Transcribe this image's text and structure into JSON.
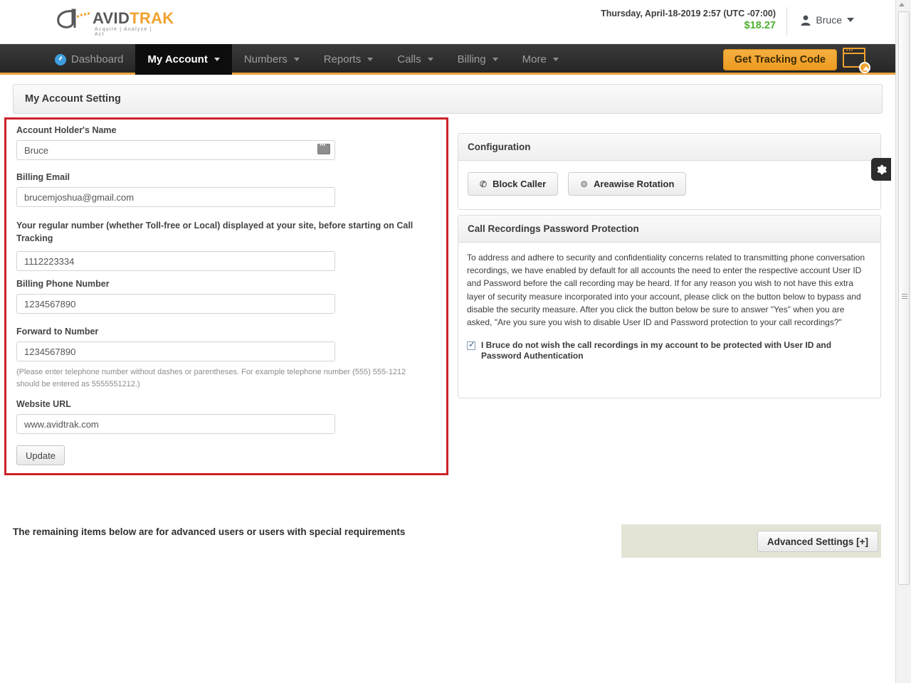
{
  "header": {
    "logo": {
      "mark": "a-mark",
      "avid": "AVID",
      "trak": "TRAK",
      "tagline": "Acquire  |  Analyze  |  Act"
    },
    "datetime": "Thursday, April-18-2019 2:57 (UTC -07:00)",
    "balance": "$18.27",
    "balance_color": "#4caf2f",
    "user_name": "Bruce",
    "user_icon": "user-icon",
    "caret_icon": "chevron-down-icon"
  },
  "nav": {
    "items": [
      {
        "label": "Dashboard",
        "icon": "dashboard-icon",
        "has_caret": false,
        "active": false
      },
      {
        "label": "My Account",
        "icon": "",
        "has_caret": true,
        "active": true
      },
      {
        "label": "Numbers",
        "icon": "",
        "has_caret": true,
        "active": false
      },
      {
        "label": "Reports",
        "icon": "",
        "has_caret": true,
        "active": false
      },
      {
        "label": "Calls",
        "icon": "",
        "has_caret": true,
        "active": false
      },
      {
        "label": "Billing",
        "icon": "",
        "has_caret": true,
        "active": false
      },
      {
        "label": "More",
        "icon": "",
        "has_caret": true,
        "active": false
      }
    ],
    "tracking_button": "Get Tracking Code",
    "tracking_icon": "browser-window-icon",
    "accent_color": "#e8a33d"
  },
  "page": {
    "title": "My Account Setting"
  },
  "form": {
    "highlight_color": "#cc2229",
    "fields": [
      {
        "label": "Account Holder's Name",
        "value": "Bruce",
        "name": "account-holder-name",
        "ime_icon": "ime-indicator-icon"
      },
      {
        "label": "Billing Email",
        "value": "brucemjoshua@gmail.com",
        "name": "billing-email"
      },
      {
        "label": "Your regular number (whether Toll-free or Local) displayed at your site, before starting on Call Tracking",
        "value": "1112223334",
        "name": "regular-number"
      },
      {
        "label": "Billing Phone Number",
        "value": "1234567890",
        "name": "billing-phone-number"
      },
      {
        "label": "Forward to Number",
        "value": "1234567890",
        "name": "forward-to-number"
      },
      {
        "label": "Website URL",
        "value": "www.avidtrak.com",
        "name": "website-url"
      }
    ],
    "helper_text": "(Please enter telephone number without dashes or parentheses. For example telephone number (555) 555-1212 should be entered as 5555551212.)",
    "update_button": "Update"
  },
  "configuration": {
    "title": "Configuration",
    "buttons": [
      {
        "label": "Block Caller",
        "icon": "phone-block-icon"
      },
      {
        "label": "Areawise Rotation",
        "icon": "rotation-gear-icon"
      }
    ]
  },
  "call_recordings": {
    "title": "Call Recordings Password Protection",
    "body": "To address and adhere to security and confidentiality concerns related to transmitting phone conversation recordings, we have enabled by default for all accounts the need to enter the respective account User ID and Password before the call recording may be heard. If for any reason you wish to not have this extra layer of security measure incorporated into your account, please click on the button below to bypass and disable the security measure. After you click the button below be sure to answer \"Yes\" when you are asked, \"Are you sure you wish to disable User ID and Password protection to your call recordings?\"",
    "checkbox_label": "I Bruce do not wish the call recordings in my account to be protected with User ID and Password Authentication",
    "checkbox_checked": true
  },
  "gear_tab": {
    "icon": "gear-icon"
  },
  "footer": {
    "note": "The remaining items below are for advanced users or users with special requirements",
    "advanced_button": "Advanced Settings [+]",
    "box_color": "#e4e4d6"
  },
  "scrollbar": {
    "up_icon": "scroll-up-arrow-icon",
    "grip_icon": "scrollbar-grip-icon"
  }
}
